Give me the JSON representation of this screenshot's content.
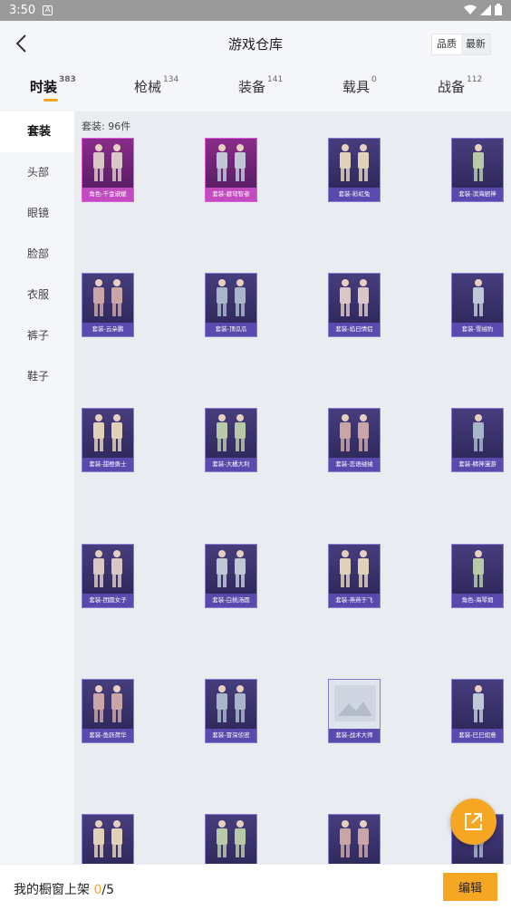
{
  "status": {
    "time": "3:50",
    "notif": "A"
  },
  "header": {
    "title": "游戏仓库",
    "sort": [
      "品质",
      "最新"
    ]
  },
  "tabs": [
    {
      "label": "时装",
      "count": "383"
    },
    {
      "label": "枪械",
      "count": "134"
    },
    {
      "label": "装备",
      "count": "141"
    },
    {
      "label": "载具",
      "count": "0"
    },
    {
      "label": "战备",
      "count": "112"
    }
  ],
  "sidebar": [
    "套装",
    "头部",
    "眼镜",
    "脸部",
    "衣服",
    "裤子",
    "鞋子"
  ],
  "main": {
    "count_label": "套装: 96件"
  },
  "items": [
    "角色-千金淑媛",
    "套装-碧穹智者",
    "套装-彩虹兔",
    "套装-滨海厨神",
    "套装-云朵鹏",
    "套装-顶瓜瓜",
    "套装-焰日情侣",
    "套装-雪绒豹",
    "套装-甜橙勇士",
    "套装-大橘大利",
    "套装-恋语绒绒",
    "套装-精神漫游",
    "套装-团圆女子",
    "套装-白桃汤圆",
    "套装-燕燕于飞",
    "角色-海琴烟",
    "套装-鱼跃荷华",
    "套装-冒深侦密",
    "套装-战术大师",
    "套装-巳巳如意",
    "",
    "",
    "",
    ""
  ],
  "colors": {
    "accent": "#f5a623",
    "card": "#473d7e",
    "legendary": "#8a2c8a"
  },
  "footer": {
    "label": "我的橱窗上架",
    "current": "0",
    "total": "/5",
    "edit": "编辑"
  },
  "fab": {
    "icon": "share-external-icon"
  }
}
